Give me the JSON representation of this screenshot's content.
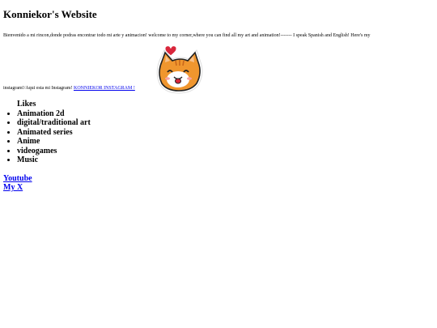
{
  "page": {
    "title": "Konniekor's Website",
    "intro_text": "Bienvenido a mi rincon,donde podras encontrar todo mi arte y animacion! welcome to my corner,where you can find all my art and animation!------- I speak Spanish and English! Here's my",
    "intro_text_after": "instagram!/Aqui esta mi Instagram!",
    "instagram_link": "KONNIEKOR INSTAGRAM !",
    "cat_sticker": "cat-sticker-icon"
  },
  "likes": {
    "header": "Likes",
    "items": [
      "Animation 2d",
      "digital/traditional art",
      "Animated series",
      "Anime",
      "videogames",
      "Music"
    ]
  },
  "links": {
    "youtube": "Youtube",
    "x": "My X"
  },
  "colors": {
    "link": "#0000ee",
    "cat_orange": "#f0962e",
    "heart": "#d9263b"
  }
}
